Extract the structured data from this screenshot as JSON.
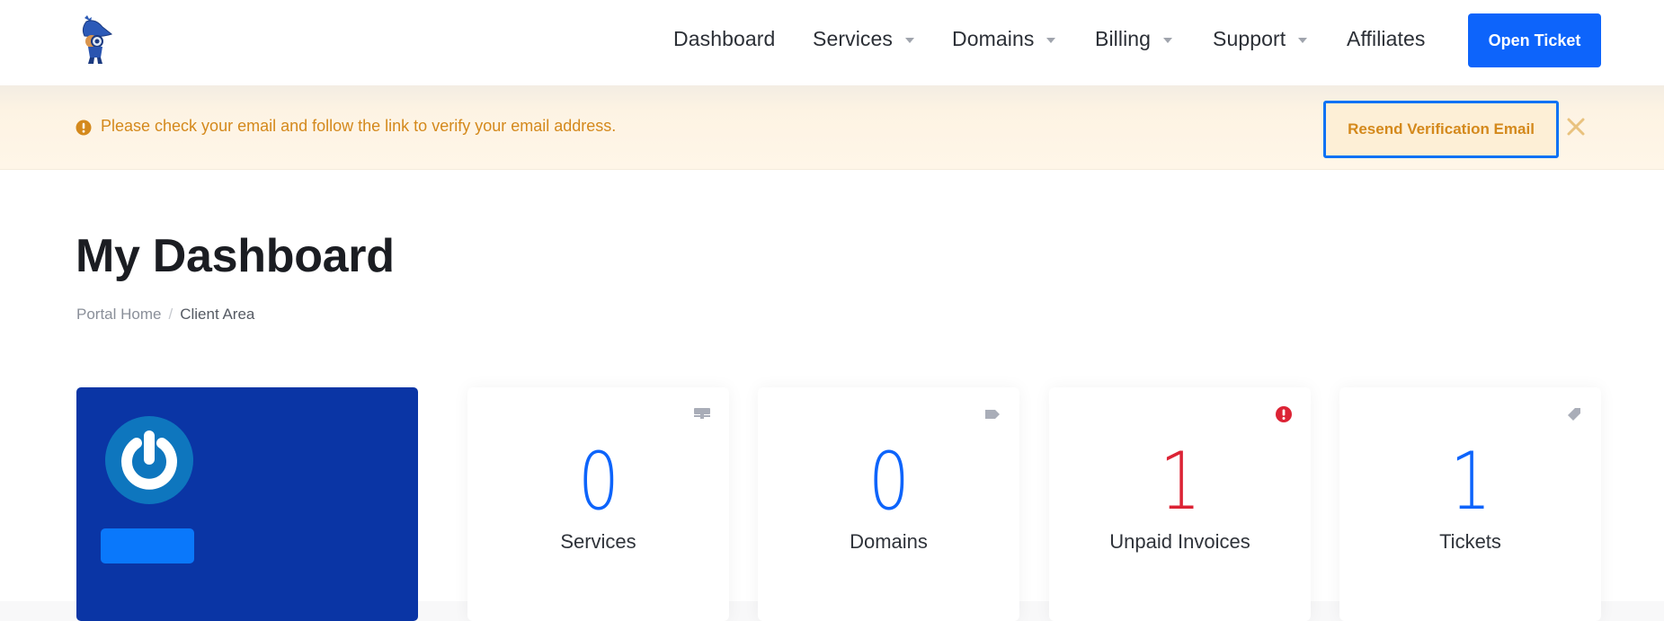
{
  "header": {
    "logo_alt": "detective mascot logo",
    "nav": [
      {
        "label": "Dashboard",
        "has_dropdown": false
      },
      {
        "label": "Services",
        "has_dropdown": true
      },
      {
        "label": "Domains",
        "has_dropdown": true
      },
      {
        "label": "Billing",
        "has_dropdown": true
      },
      {
        "label": "Support",
        "has_dropdown": true
      },
      {
        "label": "Affiliates",
        "has_dropdown": false
      }
    ],
    "open_ticket_label": "Open Ticket"
  },
  "alert": {
    "icon": "exclamation-circle-icon",
    "message": "Please check your email and follow the link to verify your email address.",
    "resend_label": "Resend Verification Email",
    "close_icon": "close-icon"
  },
  "page": {
    "title": "My Dashboard",
    "breadcrumb": [
      {
        "label": "Portal Home",
        "link": true
      },
      {
        "label": "Client Area",
        "link": false
      }
    ],
    "breadcrumb_separator": "/"
  },
  "stats": [
    {
      "value": "0",
      "label": "Services",
      "icon": "server-icon",
      "color": "#0d64fb"
    },
    {
      "value": "0",
      "label": "Domains",
      "icon": "tag-icon",
      "color": "#0d64fb"
    },
    {
      "value": "1",
      "label": "Unpaid Invoices",
      "icon": "exclamation-circle-icon",
      "color": "#dc2335"
    },
    {
      "value": "1",
      "label": "Tickets",
      "icon": "ticket-icon",
      "color": "#0d64fb"
    }
  ],
  "colors": {
    "brand_blue": "#0d64fb",
    "alert_text": "#d4891c",
    "danger": "#dc2335",
    "profile_card": "#0a35a5"
  }
}
